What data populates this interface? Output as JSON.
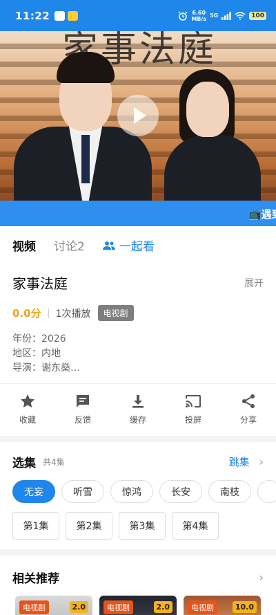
{
  "status_bar": {
    "time": "11:22",
    "net_speed": "6.60",
    "net_unit": "MB/s",
    "network": "5G",
    "battery": "100"
  },
  "banner": {
    "text": "📺遇到"
  },
  "tabs": [
    {
      "label": "视频"
    },
    {
      "label": "讨论2"
    },
    {
      "label": "一起看"
    }
  ],
  "info": {
    "title": "家事法庭",
    "expand": "展开",
    "score": "0.0分",
    "plays": "1次播放",
    "badge": "电视剧",
    "year": "年份：2026",
    "region": "地区：内地",
    "director": "导演：谢东燊…"
  },
  "actions": [
    {
      "label": "收藏",
      "icon": "star-icon"
    },
    {
      "label": "反馈",
      "icon": "feedback-icon"
    },
    {
      "label": "缓存",
      "icon": "download-icon"
    },
    {
      "label": "投屏",
      "icon": "cast-icon"
    },
    {
      "label": "分享",
      "icon": "share-icon"
    }
  ],
  "episodes": {
    "title": "选集",
    "count": "共4集",
    "jump": "跳集",
    "sources": [
      "无妄",
      "听雪",
      "惊鸿",
      "长安",
      "南枝",
      ""
    ],
    "list": [
      "第1集",
      "第2集",
      "第3集",
      "第4集"
    ]
  },
  "recommend": {
    "title": "相关推荐",
    "cards": [
      {
        "tag": "电视剧",
        "score": "2.0"
      },
      {
        "tag": "电视剧",
        "score": "2.0"
      },
      {
        "tag": "电视剧",
        "score": "10.0"
      }
    ]
  },
  "colors": {
    "accent": "#1f86ea",
    "score": "#f2a31b",
    "tag": "#e8531a"
  }
}
